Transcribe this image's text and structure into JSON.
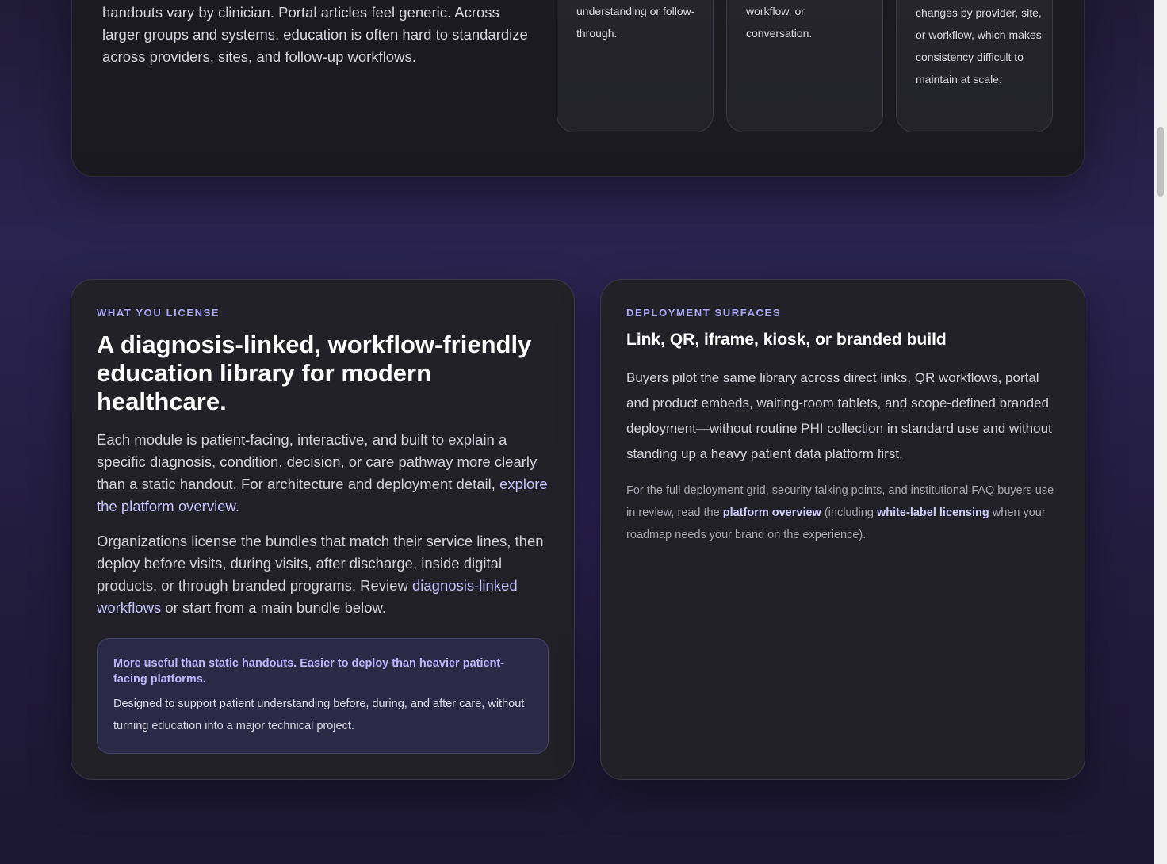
{
  "top": {
    "text": "handouts vary by clinician. Portal articles feel generic. Across larger groups and systems, education is often hard to standardize across providers, sites, and follow-up workflows.",
    "cards": [
      "easy to hand out, but it rarely creates durable understanding or follow-through.",
      "disconnected from the actual specialty, workflow, or conversation.",
      "changes by provider, site, or workflow, which makes consistency difficult to maintain at scale."
    ]
  },
  "license": {
    "eyebrow": "WHAT YOU LICENSE",
    "headline": "A diagnosis-linked, workflow-friendly education library for modern healthcare.",
    "p1_text": "Each module is patient-facing, interactive, and built to explain a specific diagnosis, condition, decision, or care pathway more clearly than a static handout. For architecture and deployment detail, ",
    "p1_link": "explore the platform overview",
    "p1_end": ".",
    "p2_text": "Organizations license the bundles that match their service lines, then deploy before visits, during visits, after discharge, inside digital products, or through branded programs. Review ",
    "p2_link": "diagnosis-linked workflows",
    "p2_end": " or start from a main bundle below.",
    "callout_title": "More useful than static handouts. Easier to deploy than heavier patient-facing platforms.",
    "callout_body": "Designed to support patient understanding before, during, and after care, without turning education into a major technical project."
  },
  "deployment": {
    "eyebrow": "DEPLOYMENT SURFACES",
    "subhead": "Link, QR, iframe, kiosk, or branded build",
    "body": "Buyers pilot the same library across direct links, QR workflows, portal and product embeds, waiting-room tablets, and scope-defined branded deployment—without routine PHI collection in standard use and without standing up a heavy patient data platform first.",
    "note_1": "For the full deployment grid, security talking points, and institutional FAQ buyers use in review, read the ",
    "note_link_1": "platform overview",
    "note_2": " (including ",
    "note_link_2": "white-label licensing",
    "note_3": " when your roadmap needs your brand on the experience)."
  }
}
